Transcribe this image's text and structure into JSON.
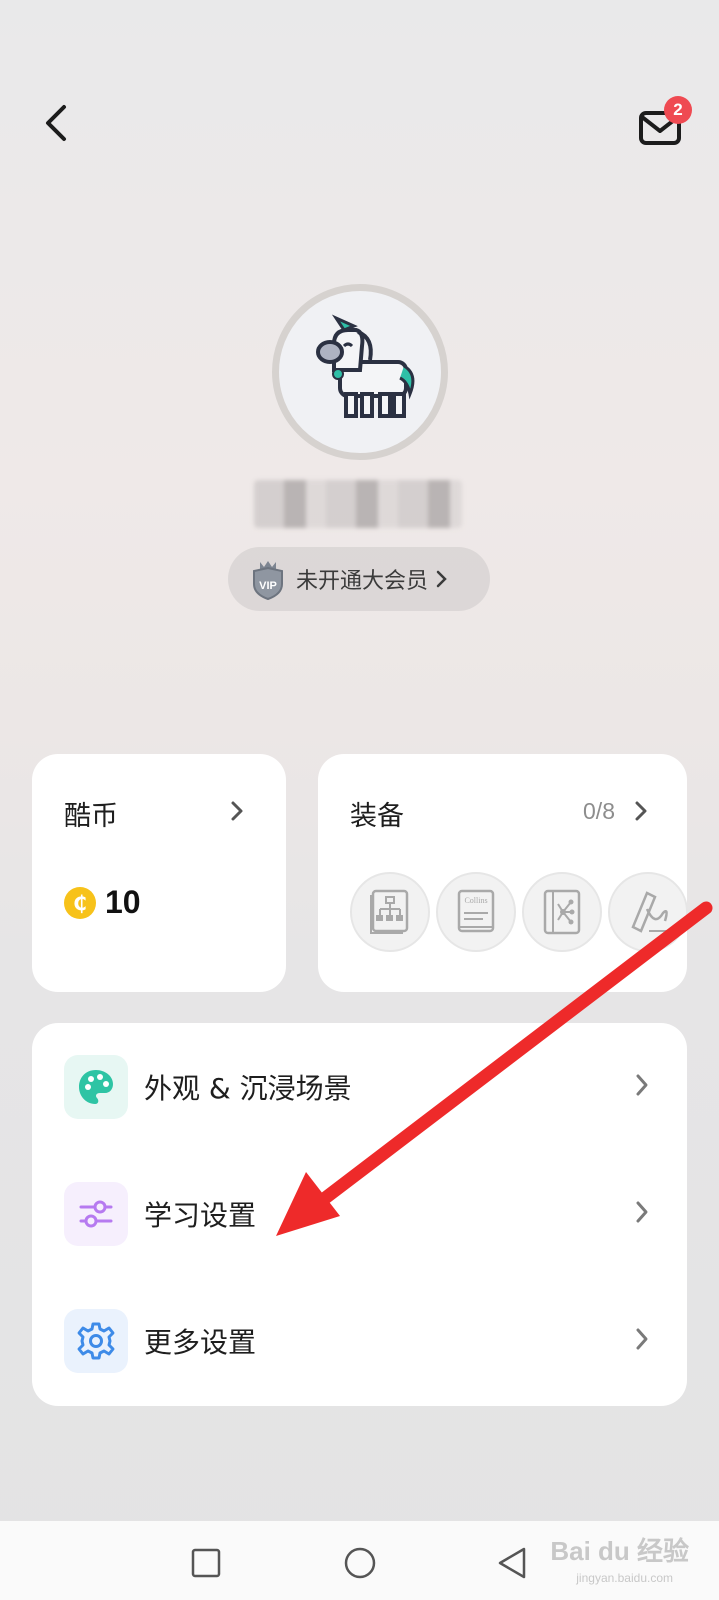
{
  "header": {
    "back_icon": "chevron-left-icon",
    "mail_icon": "mail-icon",
    "mail_badge": "2"
  },
  "profile": {
    "avatar_icon": "unicorn-avatar",
    "vip_icon": "vip-shield-icon",
    "vip_label": "未开通大会员"
  },
  "coin_card": {
    "title": "酷币",
    "coin_icon_glyph": "₵",
    "value": "10"
  },
  "equip_card": {
    "title": "装备",
    "count": "0/8",
    "slots": [
      "mind-map-icon",
      "collins-dictionary-icon",
      "tree-diagram-icon",
      "handwriting-icon"
    ],
    "collins_label": "Collins"
  },
  "settings": {
    "items": [
      {
        "label": "外观 & 沉浸场景",
        "icon": "palette-icon",
        "color": "#2ec4a4"
      },
      {
        "label": "学习设置",
        "icon": "sliders-icon",
        "color": "#b67af0"
      },
      {
        "label": "更多设置",
        "icon": "gear-icon",
        "color": "#3e8be8"
      }
    ]
  },
  "nav": {
    "items": [
      "recent-apps-icon",
      "home-icon",
      "back-triangle-icon"
    ],
    "watermark": "Bai du 经验",
    "watermark_sub": "jingyan.baidu.com"
  },
  "colors": {
    "badge": "#ef4a52",
    "coin": "#f7c21a",
    "annotation": "#ee2a2a"
  }
}
